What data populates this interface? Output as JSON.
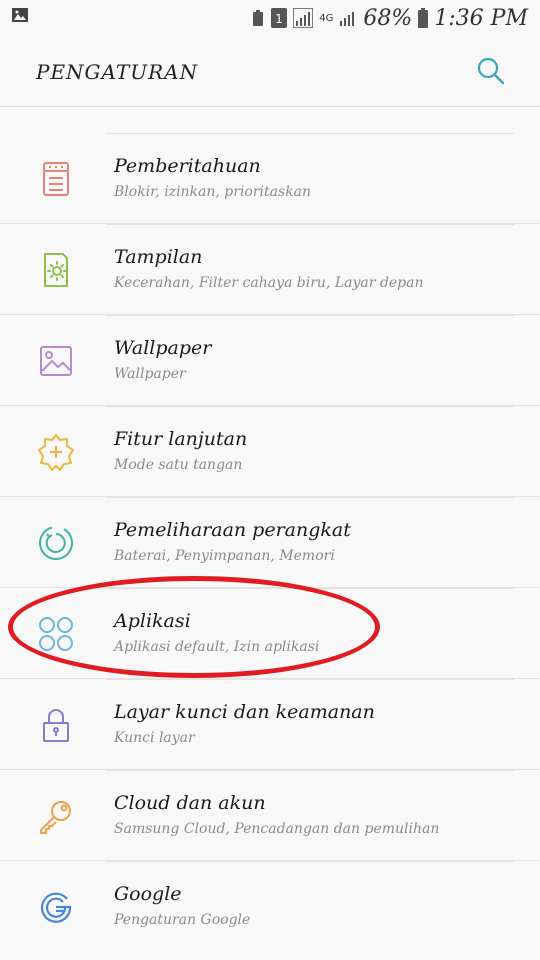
{
  "status": {
    "battery": "68%",
    "time": "1:36 PM",
    "sim": "1",
    "network": "4G"
  },
  "header": {
    "title": "PENGATURAN"
  },
  "items": [
    {
      "label": "Pemberitahuan",
      "sub": "Blokir, izinkan, prioritaskan",
      "icon": "notifications-icon",
      "color": "#e8837a"
    },
    {
      "label": "Tampilan",
      "sub": "Kecerahan, Filter cahaya biru, Layar depan",
      "icon": "display-icon",
      "color": "#8cc24a"
    },
    {
      "label": "Wallpaper",
      "sub": "Wallpaper",
      "icon": "wallpaper-icon",
      "color": "#b58ad0"
    },
    {
      "label": "Fitur lanjutan",
      "sub": "Mode satu tangan",
      "icon": "advanced-features-icon",
      "color": "#f2b33d"
    },
    {
      "label": "Pemeliharaan perangkat",
      "sub": "Baterai, Penyimpanan, Memori",
      "icon": "device-maintenance-icon",
      "color": "#3eb3a0"
    },
    {
      "label": "Aplikasi",
      "sub": "Aplikasi default, Izin aplikasi",
      "icon": "apps-icon",
      "color": "#6cb6dd"
    },
    {
      "label": "Layar kunci dan keamanan",
      "sub": "Kunci layar",
      "icon": "lock-icon",
      "color": "#8a78d0"
    },
    {
      "label": "Cloud dan akun",
      "sub": "Samsung Cloud, Pencadangan dan pemulihan",
      "icon": "key-icon",
      "color": "#f0a04b"
    },
    {
      "label": "Google",
      "sub": "Pengaturan Google",
      "icon": "google-icon",
      "color": "#4a86d8"
    }
  ]
}
